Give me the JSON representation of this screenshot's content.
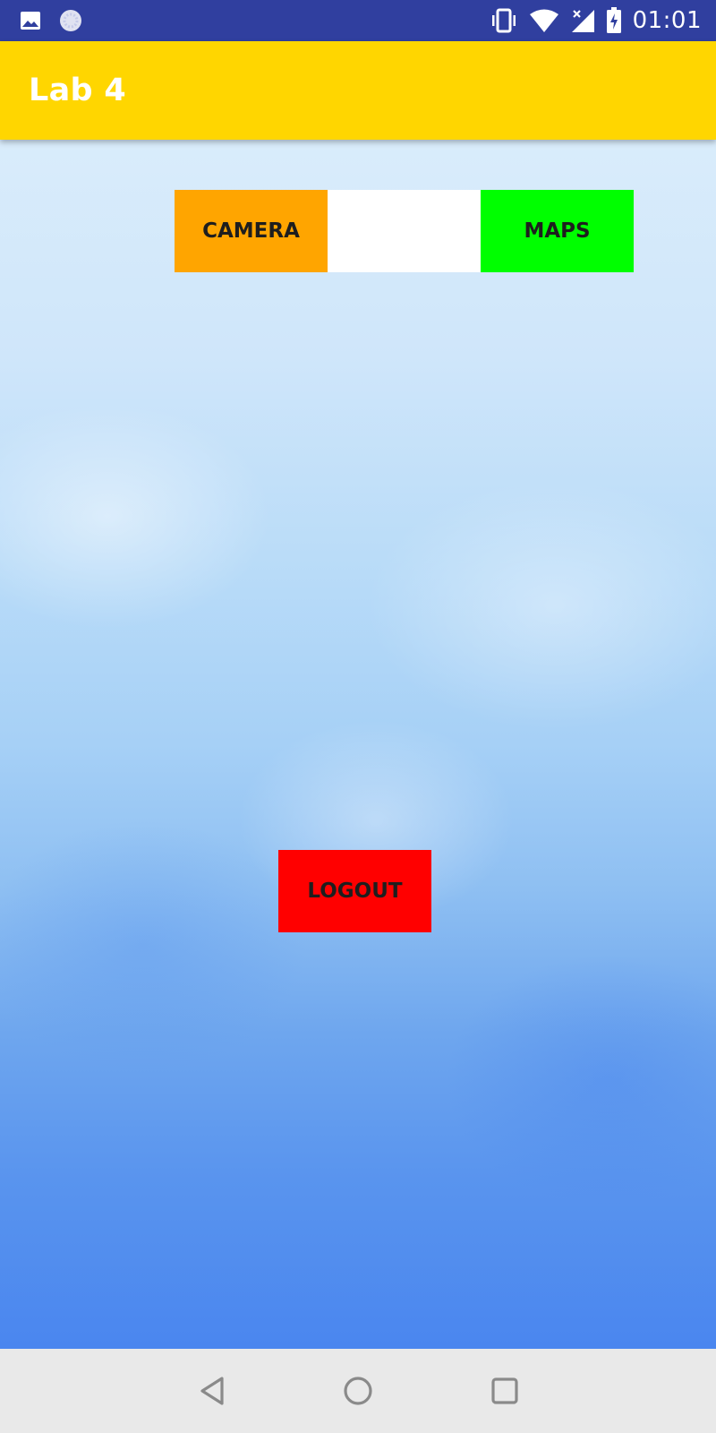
{
  "status_bar": {
    "time": "01:01",
    "left_icons": [
      "image-icon",
      "loading-icon"
    ],
    "right_icons": [
      "vibrate-icon",
      "wifi-icon",
      "no-signal-icon",
      "battery-charging-icon"
    ],
    "bar_color": "#303f9f"
  },
  "app_bar": {
    "title": "Lab 4",
    "color": "#ffd600"
  },
  "buttons": {
    "camera": {
      "label": "CAMERA",
      "color": "#ffa500"
    },
    "middle": {
      "label": "",
      "color": "#ffffff"
    },
    "maps": {
      "label": "MAPS",
      "color": "#00ff00"
    },
    "logout": {
      "label": "LOGOUT",
      "color": "#ff0000"
    }
  },
  "nav_bar": {
    "icons": [
      "back-icon",
      "home-icon",
      "recents-icon"
    ]
  }
}
